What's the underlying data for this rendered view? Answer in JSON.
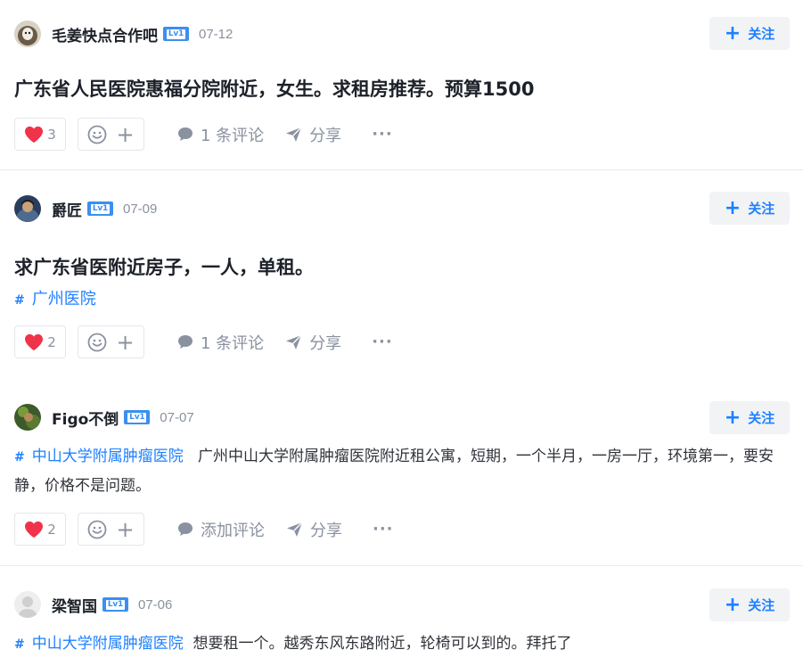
{
  "follow_label": "关注",
  "posts": [
    {
      "username": "毛姜快点合作吧",
      "level": "Lv1",
      "date": "07-12",
      "title": "广东省人民医院惠福分院附近，女生。求租房推荐。预算1500",
      "likes": "3",
      "comment_label": "1 条评论",
      "share_label": "分享",
      "more_label": "···"
    },
    {
      "username": "爵匠",
      "level": "Lv1",
      "date": "07-09",
      "title": "求广东省医附近房子，一人，单租。",
      "topic": "广州医院",
      "likes": "2",
      "comment_label": "1 条评论",
      "share_label": "分享",
      "more_label": "···"
    },
    {
      "username": "Figo不倒",
      "level": "Lv1",
      "date": "07-07",
      "topic": "中山大学附属肿瘤医院",
      "content": "广州中山大学附属肿瘤医院附近租公寓，短期，一个半月，一房一厅，环境第一，要安静，价格不是问题。",
      "likes": "2",
      "comment_label": "添加评论",
      "share_label": "分享",
      "more_label": "···"
    },
    {
      "username": "梁智国",
      "level": "Lv1",
      "date": "07-06",
      "topic": "中山大学附属肿瘤医院",
      "content": "想要租一个。越秀东风东路附近，轮椅可以到的。拜托了"
    }
  ],
  "colors": {
    "accent": "#1e80ff",
    "heart": "#f0334a",
    "muted": "#8a919f",
    "level_badge": "#3b8ff0"
  },
  "icons": {
    "follow": "plus-icon",
    "like": "heart-icon",
    "emoji": "smiley-icon",
    "comment": "speech-bubble-icon",
    "share": "paper-plane-icon",
    "topic": "hash-icon"
  }
}
